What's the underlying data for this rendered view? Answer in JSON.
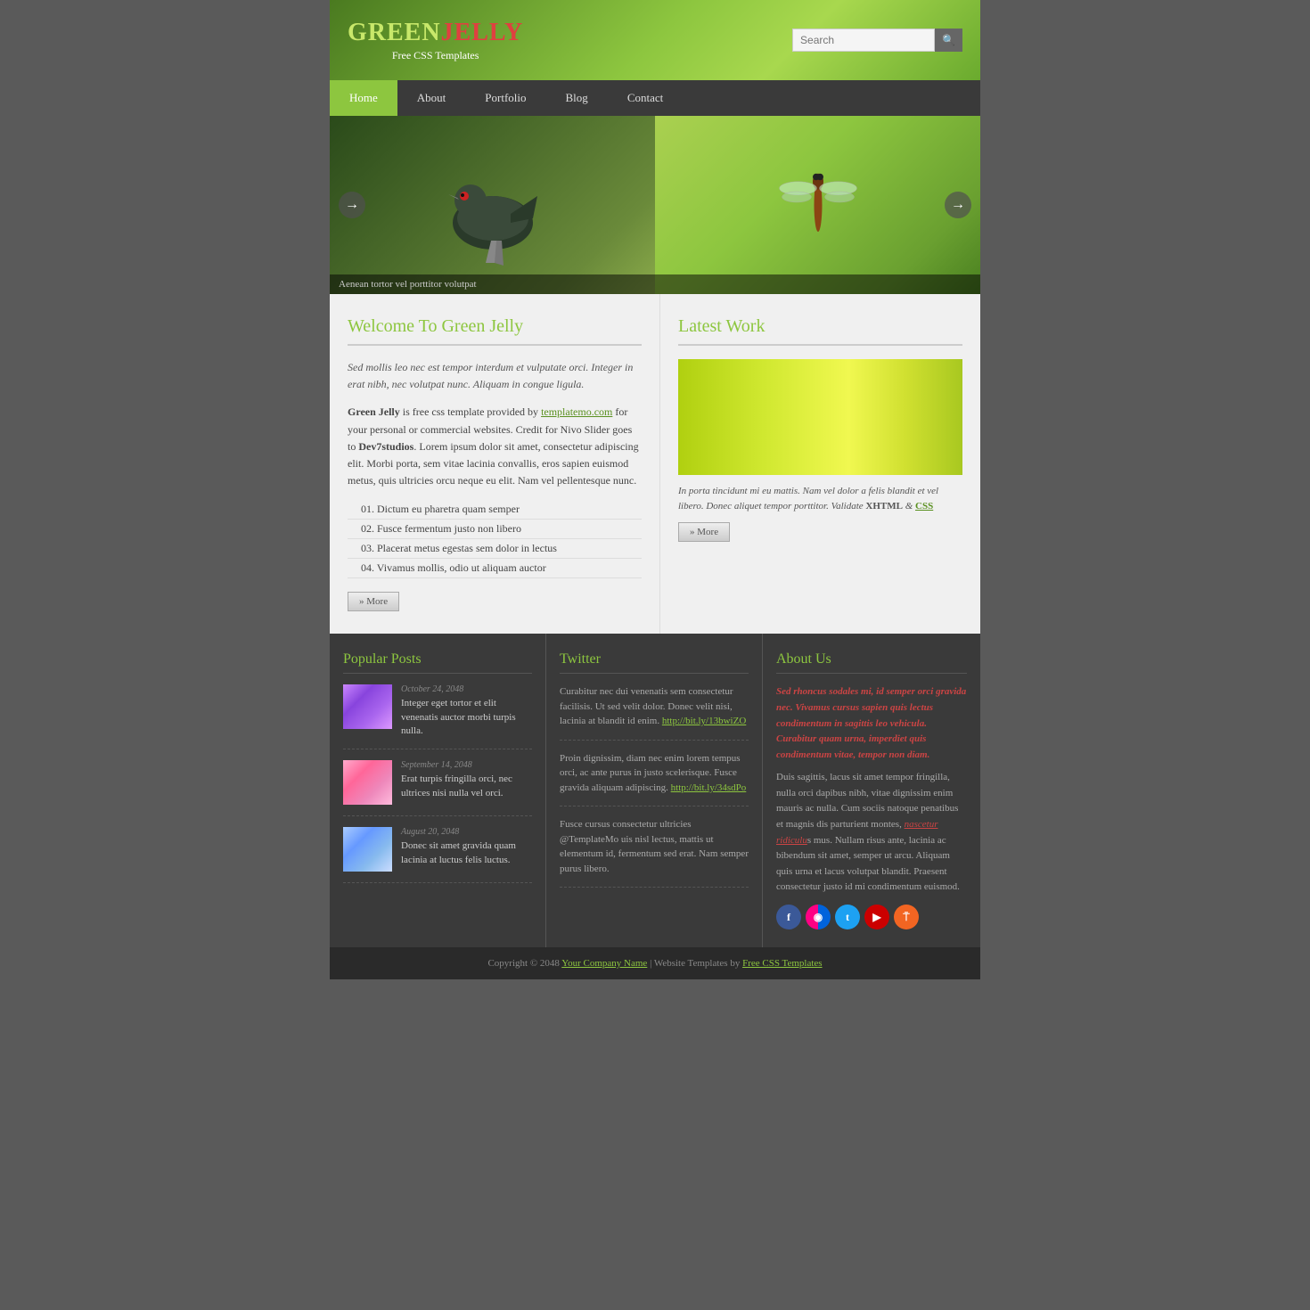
{
  "header": {
    "logo_green": "GREEN",
    "logo_jelly": "JELLY",
    "logo_tagline": "Free CSS Templates",
    "search_placeholder": "Search",
    "search_button_label": "🔍"
  },
  "nav": {
    "items": [
      {
        "label": "Home",
        "active": true
      },
      {
        "label": "About",
        "active": false
      },
      {
        "label": "Portfolio",
        "active": false
      },
      {
        "label": "Blog",
        "active": false
      },
      {
        "label": "Contact",
        "active": false
      }
    ]
  },
  "slider": {
    "caption": "Aenean tortor vel porttitor volutpat"
  },
  "welcome": {
    "title": "Welcome To Green Jelly",
    "intro": "Sed mollis leo nec est tempor interdum et vulputate orci. Integer in erat nibh, nec volutpat nunc. Aliquam in congue ligula.",
    "body1": "Green Jelly is free css template provided by templatemo.com for your personal or commercial websites. Credit for Nivo Slider goes to Dev7studios. Lorem ipsum dolor sit amet, consectetur adipiscing elit. Morbi porta, sem vitae lacinia convallis, eros sapien euismod metus, quis ultricies orcu neque eu elit. Nam vel pellentesque nunc.",
    "list": [
      "01.  Dictum eu pharetra quam semper",
      "02.  Fusce fermentum justo non libero",
      "03.  Placerat metus egestas sem dolor in lectus",
      "04.  Vivamus mollis, odio ut aliquam auctor"
    ],
    "more_btn": "» More"
  },
  "latest_work": {
    "title": "Latest Work",
    "caption": "In porta tincidunt mi eu mattis. Nam vel dolor a felis blandit et vel libero. Donec aliquet tempor porttitor. Validate ",
    "xhtml": "XHTML",
    "ampersand": " & ",
    "css": "CSS",
    "more_btn": "» More"
  },
  "popular_posts": {
    "title": "Popular Posts",
    "items": [
      {
        "date": "October 24, 2048",
        "text": "Integer eget tortor et elit venenatis auctor morbi turpis nulla."
      },
      {
        "date": "September 14, 2048",
        "text": "Erat turpis fringilla orci, nec ultrices nisi nulla vel orci."
      },
      {
        "date": "August 20, 2048",
        "text": "Donec sit amet gravida quam lacinia at luctus felis luctus."
      }
    ]
  },
  "twitter": {
    "title": "Twitter",
    "items": [
      {
        "text": "Curabitur nec dui venenatis sem consectetur facilisis. Ut sed velit dolor. Donec velit nisi, lacinia at blandit id enim. ",
        "link": "http://bit.ly/13bwiZO"
      },
      {
        "text": "Proin dignissim, diam nec enim lorem tempus orci, ac ante purus in justo scelerisque. Fusce gravida aliquam adipiscing. ",
        "link": "http://bit.ly/34sdPo"
      },
      {
        "text": "Fusce cursus consectetur ultricies @TemplateMo uis nisl lectus, mattis ut elementum id, fermentum sed erat. Nam semper purus libero.",
        "link": ""
      }
    ]
  },
  "about_us": {
    "title": "About Us",
    "para1": "Sed rhoncus sodales mi, id semper orci gravida nec. Vivamus cursus sapien quis lectus condimentum in sagittis leo vehicula. Curabitur quam urna, imperdiet quis condimentum vitae, tempor non diam.",
    "para2": "Duis sagittis, lacus sit amet tempor fringilla, nulla orci dapibus nibh, vitae dignissim enim mauris ac nulla. Cum sociis natoque penatibus et magnis dis parturient montes, ",
    "link_text": "nascetur ridiculu",
    "para2b": "s mus. Nullam risus ante, lacinia ac bibendum sit amet, semper ut arcu. Aliquam quis urna et lacus volutpat blandit. Praesent consectetur justo id mi condimentum euismod."
  },
  "footer_bottom": {
    "text": "Copyright © 2048 ",
    "company": "Your Company Name",
    "middle": " | Website Templates by ",
    "templates": "Free CSS Templates"
  }
}
